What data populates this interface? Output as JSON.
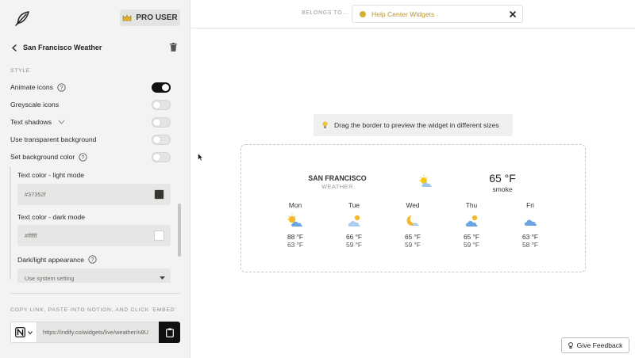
{
  "sidebar": {
    "badge": "PRO USER",
    "widget_title": "San Francisco Weather",
    "style_heading": "STYLE",
    "options": [
      {
        "label": "Animate icons",
        "on": true
      },
      {
        "label": "Greyscale icons",
        "on": false
      },
      {
        "label": "Text shadows",
        "on": false
      },
      {
        "label": "Use transparent background",
        "on": false
      },
      {
        "label": "Set background color",
        "on": false
      }
    ],
    "text_color_light_label": "Text color - light mode",
    "text_color_light_value": "#37352f",
    "text_color_dark_label": "Text color - dark mode",
    "text_color_dark_value": "#ffffff",
    "appearance_label": "Dark/light appearance",
    "appearance_value": "Use system setting",
    "copy_heading": "COPY LINK, PASTE INTO NOTION, AND CLICK 'EMBED'",
    "link_url": "https://indify.co/widgets/live/weather/n8U"
  },
  "topbar": {
    "belongs_label": "BELONGS TO...",
    "collection": "Help Center Widgets"
  },
  "preview": {
    "hint": "Drag the border to preview the widget in different sizes",
    "feedback": "Give Feedback"
  },
  "weather": {
    "city": "SAN FRANCISCO",
    "subtitle": "WEATHER",
    "current_temp": "65 °F",
    "current_condition": "smoke",
    "current_icon": "sun-behind-cloud-icon",
    "days": [
      {
        "name": "Mon",
        "high": "88 °F",
        "low": "63 °F",
        "icon": "partly-sunny-icon"
      },
      {
        "name": "Tue",
        "high": "66 °F",
        "low": "59 °F",
        "icon": "cloud-with-sun-icon"
      },
      {
        "name": "Wed",
        "high": "65 °F",
        "low": "59 °F",
        "icon": "crescent-moon-cloud-icon"
      },
      {
        "name": "Thu",
        "high": "65 °F",
        "low": "59 °F",
        "icon": "cloud-with-sun-icon"
      },
      {
        "name": "Fri",
        "high": "63 °F",
        "low": "58 °F",
        "icon": "cloud-icon"
      }
    ]
  },
  "colors": {
    "accent_dot": "#d3b037",
    "toggle_on": "#111111",
    "swatch_light": "#37352f",
    "swatch_dark": "#ffffff"
  }
}
